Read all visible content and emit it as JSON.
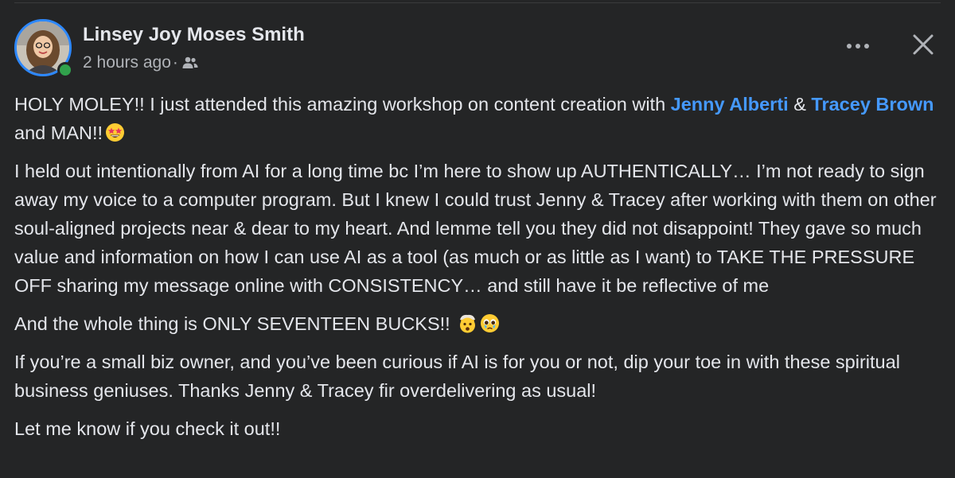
{
  "post": {
    "author_name": "Linsey Joy Moses Smith",
    "timestamp": "2 hours ago",
    "separator": "·",
    "audience_icon": "group-icon",
    "header_icons": {
      "more": "more-options-icon",
      "close": "close-icon"
    },
    "colors": {
      "background": "#242526",
      "text": "#E4E6EB",
      "secondary_text": "#B0B3B8",
      "mention": "#4599FF",
      "avatar_ring": "#2D88FF",
      "online": "#31A24C"
    },
    "paragraphs": {
      "p1": {
        "text_a": "HOLY MOLEY!! I just attended this amazing workshop on content creation with ",
        "mention_a": "Jenny Alberti",
        "text_b": " & ",
        "mention_b": "Tracey Brown",
        "text_c": " and MAN!!",
        "emoji": "star-struck-emoji"
      },
      "p2": "I held out intentionally from AI for a long time bc I’m here to show up AUTHENTICALLY… I’m not ready to sign away my voice to a computer program. But I knew I could trust Jenny & Tracey after working with them on other soul-aligned projects near & dear to my heart. And lemme tell you they did not disappoint!  They gave so much value and information on how I can use AI as a tool (as much or as little as I want) to TAKE THE PRESSURE OFF sharing my message online with CONSISTENCY… and still have it be reflective of me",
      "p3": {
        "text": "And the whole thing is ONLY SEVENTEEN BUCKS!!",
        "emojis": [
          "exploding-head-emoji",
          "pleading-face-emoji"
        ]
      },
      "p4": "If you’re a small biz owner, and you’ve been curious if AI is for you or not, dip your toe in with these spiritual business geniuses. Thanks Jenny & Tracey fir overdelivering as usual!",
      "p5": "Let me know if you check it out!!"
    }
  }
}
